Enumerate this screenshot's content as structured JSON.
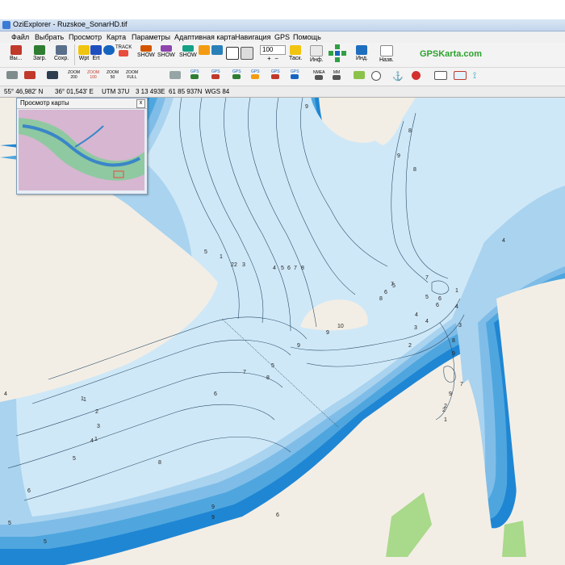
{
  "window": {
    "title": "OziExplorer - Ruzskoe_SonarHD.tif"
  },
  "menu": [
    "Файл",
    "Выбрать",
    "Просмотр",
    "Карта",
    "Параметры",
    "Адаптивная карта",
    "Навигация",
    "GPS",
    "Помощь"
  ],
  "toolbar": {
    "exit_label": "Вы...",
    "load_label": "Загр.",
    "save_label": "Сохр.",
    "wpt_label": "Wpt",
    "ert_label": "Ert",
    "track_label": "TRACK",
    "show_label": "SHOW",
    "zoom_value": "100",
    "task_label": "Таск.",
    "info_label": "Инф.",
    "ind_label": "Инд.",
    "back_label": "Назв."
  },
  "toolbar2": {
    "zoom_buttons": [
      "ZOOM\n200",
      "ZOOM\n100",
      "ZOOM\n50",
      "ZOOM\nFULL"
    ],
    "gps_labels": [
      "GPS",
      "GPS",
      "GPS",
      "GPS",
      "GPS",
      "GPS"
    ],
    "nmea_label": "NMEA",
    "mm_label": "MM"
  },
  "brand": "GPSKarta.com",
  "status": {
    "lat": "55° 46,982' N",
    "lon": "36° 01,543' E",
    "utm_zone": "UTM  37U",
    "easting": "3 13 493E",
    "northing": "61 85 937N",
    "datum": "WGS 84"
  },
  "overview": {
    "title": "Просмотр карты",
    "close": "x"
  },
  "colors": {
    "land": "#f3eee5",
    "water_light": "#cfe8f7",
    "water_mid": "#a9d3ef",
    "water_deep": "#4fa6de",
    "water_deepest": "#1f86d3",
    "green": "#a9d98a"
  },
  "depth_labels": [
    "9",
    "8",
    "9",
    "8",
    "4",
    "1",
    "2",
    "3",
    "4",
    "5",
    "6",
    "7",
    "8",
    "1",
    "2",
    "3",
    "4",
    "6",
    "7",
    "8",
    "9",
    "10",
    "9",
    "8",
    "7",
    "6",
    "5",
    "4",
    "3",
    "2",
    "1",
    "4",
    "5",
    "6",
    "9",
    "8",
    "7",
    "6",
    "5",
    "4",
    "3",
    "2",
    "1",
    "9",
    "8",
    "7",
    "6",
    "5",
    "4",
    "9",
    "9",
    "6",
    "5",
    "5",
    "2",
    "1",
    "5",
    "2",
    "1"
  ]
}
